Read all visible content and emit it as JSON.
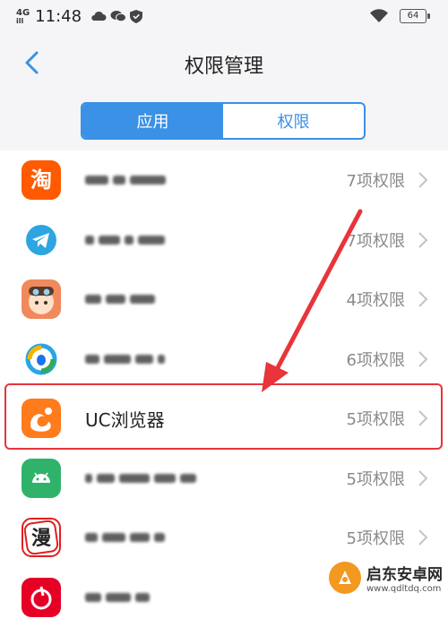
{
  "status_bar": {
    "network": "4G",
    "signal": "ill",
    "time": "11:48",
    "battery": "64"
  },
  "header": {
    "title": "权限管理",
    "back_icon": "chevron-left-icon"
  },
  "tabs": [
    {
      "label": "应用",
      "active": true
    },
    {
      "label": "权限",
      "active": false
    }
  ],
  "apps": [
    {
      "name": "",
      "blurred": true,
      "permissions": "7项权限",
      "icon": "taobao-icon"
    },
    {
      "name": "",
      "blurred": true,
      "permissions": "7项权限",
      "icon": "telegram-icon"
    },
    {
      "name": "",
      "blurred": true,
      "permissions": "4项权限",
      "icon": "anime-avatar-icon"
    },
    {
      "name": "",
      "blurred": true,
      "permissions": "6项权限",
      "icon": "qq-browser-icon"
    },
    {
      "name": "UC浏览器",
      "blurred": false,
      "permissions": "5项权限",
      "icon": "uc-browser-icon"
    },
    {
      "name": "",
      "blurred": true,
      "permissions": "5项权限",
      "icon": "android-icon"
    },
    {
      "name": "",
      "blurred": true,
      "permissions": "5项权限",
      "icon": "manga-icon"
    },
    {
      "name": "",
      "blurred": true,
      "permissions": "",
      "icon": "netease-music-icon"
    }
  ],
  "watermark": {
    "name": "启东安卓网",
    "url": "www.qdltdq.com"
  },
  "colors": {
    "accent": "#3a91e5",
    "annotation": "#e8343a",
    "secondary_text": "#8a8a8a"
  }
}
